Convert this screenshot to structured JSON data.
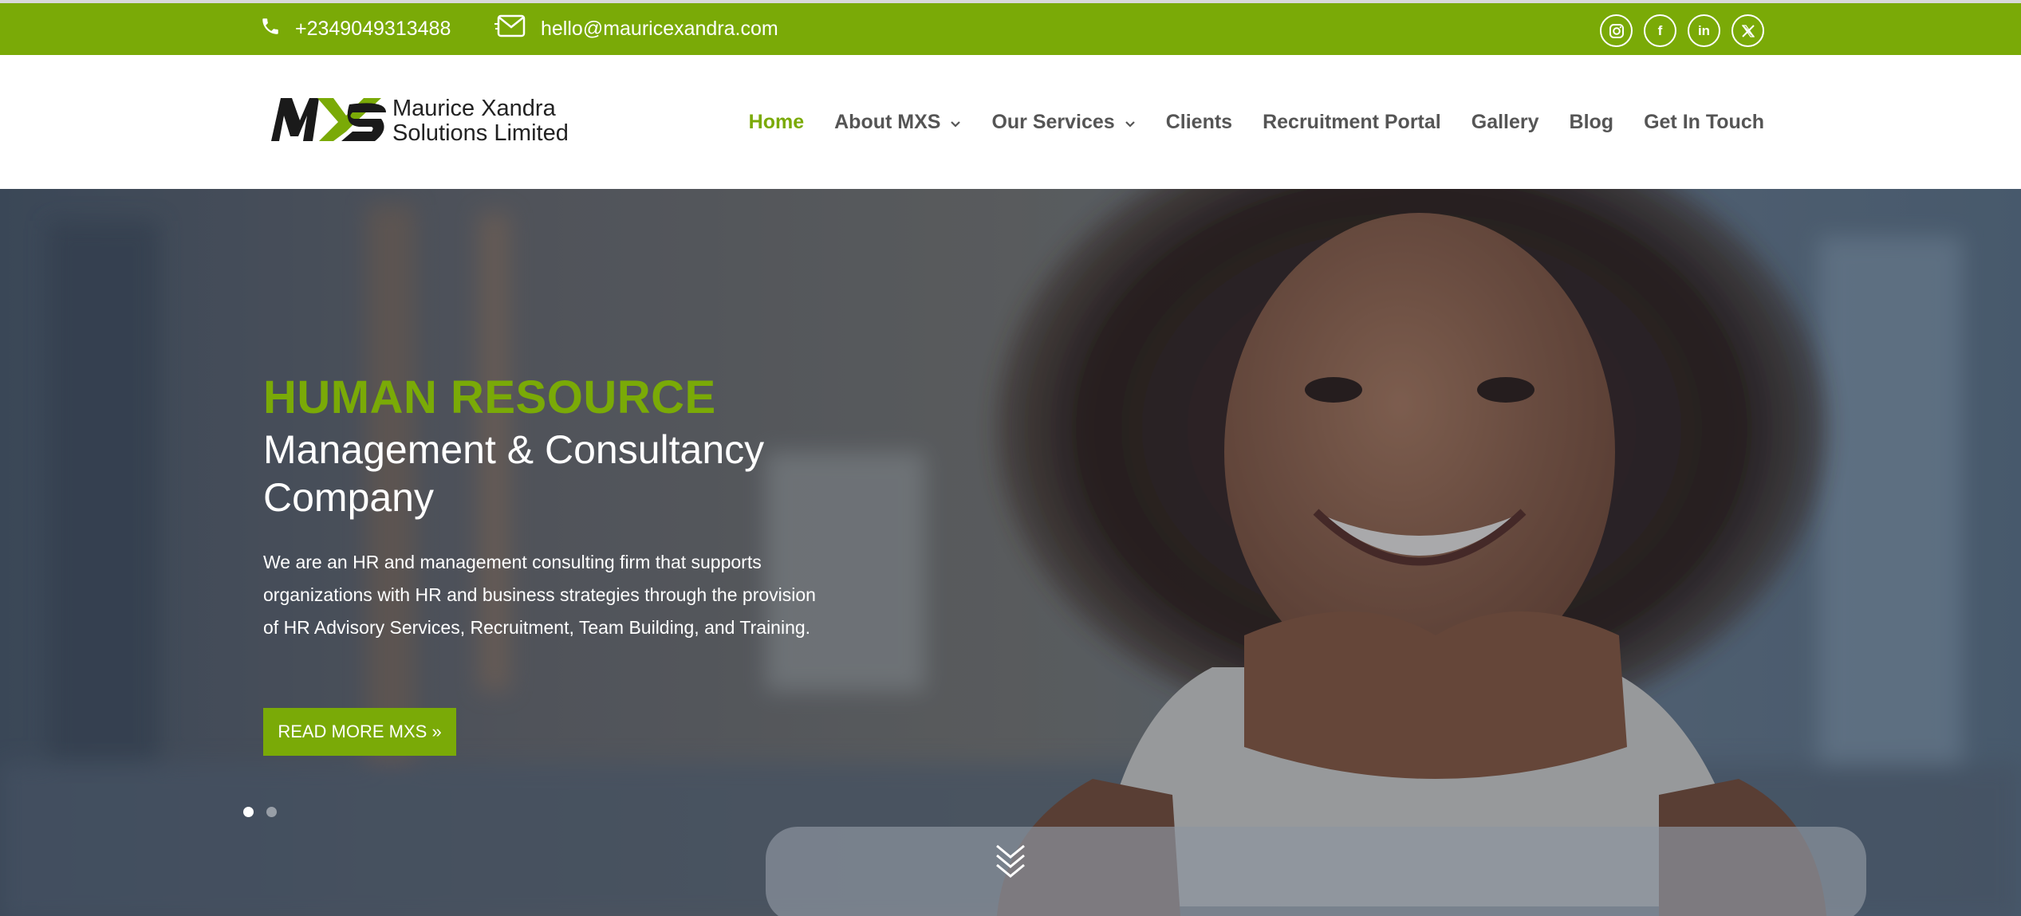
{
  "topbar": {
    "phone": "+2349049313488",
    "email": "hello@mauricexandra.com",
    "socials": [
      {
        "name": "instagram",
        "glyph": "◎"
      },
      {
        "name": "facebook",
        "glyph": "f"
      },
      {
        "name": "linkedin",
        "glyph": "in"
      },
      {
        "name": "x",
        "glyph": "𝕏"
      }
    ]
  },
  "logo": {
    "mark": "MXS",
    "line1": "Maurice Xandra",
    "line2": "Solutions Limited"
  },
  "nav": {
    "items": [
      {
        "label": "Home",
        "active": true
      },
      {
        "label": "About MXS",
        "dropdown": true
      },
      {
        "label": "Our Services",
        "dropdown": true
      },
      {
        "label": "Clients"
      },
      {
        "label": "Recruitment Portal"
      },
      {
        "label": "Gallery"
      },
      {
        "label": "Blog"
      },
      {
        "label": "Get In Touch"
      }
    ]
  },
  "hero": {
    "title": "HUMAN RESOURCE",
    "subtitle": "Management & Consultancy Company",
    "description": "We are an HR and management consulting firm that supports organizations with HR and business strategies through the provision of HR Advisory Services, Recruitment, Team Building, and Training.",
    "button_label": "READ MORE MXS  »",
    "slides": 2,
    "active_slide": 1
  },
  "colors": {
    "accent": "#7aaa07",
    "nav_text": "#555555",
    "white": "#ffffff"
  }
}
